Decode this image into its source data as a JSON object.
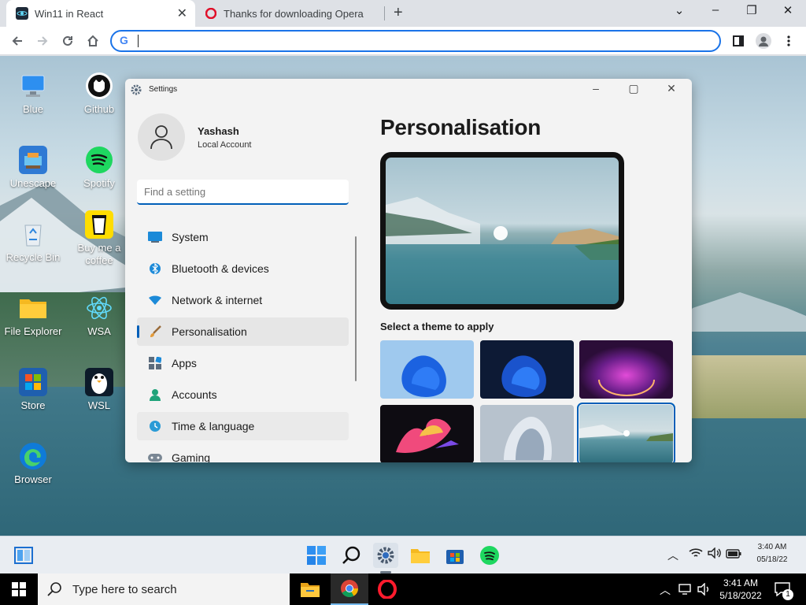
{
  "browser": {
    "tabs": [
      {
        "title": "Win11 in React",
        "active": true
      },
      {
        "title": "Thanks for downloading Opera",
        "active": false
      }
    ],
    "new_tab_label": "+",
    "address_value": "",
    "window_controls": {
      "chevron": "⌄",
      "minimize": "–",
      "restore": "❐",
      "close": "✕"
    }
  },
  "desktop": {
    "icons": [
      {
        "label": "Blue",
        "icon": "computer-icon"
      },
      {
        "label": "Github",
        "icon": "github-icon"
      },
      {
        "label": "Unescape",
        "icon": "unescape-icon"
      },
      {
        "label": "Spotify",
        "icon": "spotify-icon"
      },
      {
        "label": "Recycle Bin",
        "icon": "recycle-bin-icon"
      },
      {
        "label": "Buy me a coffee",
        "icon": "coffee-icon"
      },
      {
        "label": "File Explorer",
        "icon": "folder-icon"
      },
      {
        "label": "WSA",
        "icon": "react-icon"
      },
      {
        "label": "Store",
        "icon": "store-icon"
      },
      {
        "label": "WSL",
        "icon": "linux-penguin-icon"
      },
      {
        "label": "Browser",
        "icon": "edge-icon"
      }
    ]
  },
  "settings": {
    "window_title": "Settings",
    "user": {
      "name": "Yashash",
      "account_type": "Local Account"
    },
    "search_placeholder": "Find a setting",
    "nav": [
      {
        "label": "System",
        "icon": "system-icon"
      },
      {
        "label": "Bluetooth & devices",
        "icon": "bluetooth-icon"
      },
      {
        "label": "Network & internet",
        "icon": "wifi-icon"
      },
      {
        "label": "Personalisation",
        "icon": "brush-icon",
        "selected": true
      },
      {
        "label": "Apps",
        "icon": "apps-icon"
      },
      {
        "label": "Accounts",
        "icon": "accounts-icon"
      },
      {
        "label": "Time & language",
        "icon": "globe-clock-icon"
      },
      {
        "label": "Gaming",
        "icon": "gamepad-icon"
      }
    ],
    "heading": "Personalisation",
    "theme_prompt": "Select a theme to apply",
    "themes": [
      {
        "name": "light-bloom",
        "selected": false
      },
      {
        "name": "dark-bloom",
        "selected": false
      },
      {
        "name": "glow",
        "selected": false
      },
      {
        "name": "captured-motion",
        "selected": false
      },
      {
        "name": "flow",
        "selected": false
      },
      {
        "name": "sunrise",
        "selected": true
      }
    ]
  },
  "win11_taskbar": {
    "time": "3:40 AM",
    "date": "05/18/22",
    "apps": [
      "start-icon",
      "search-icon",
      "settings-icon",
      "file-explorer-icon",
      "store-icon",
      "spotify-icon"
    ]
  },
  "win10_taskbar": {
    "search_placeholder": "Type here to search",
    "time": "3:41 AM",
    "date": "5/18/2022",
    "notification_count": "1"
  }
}
